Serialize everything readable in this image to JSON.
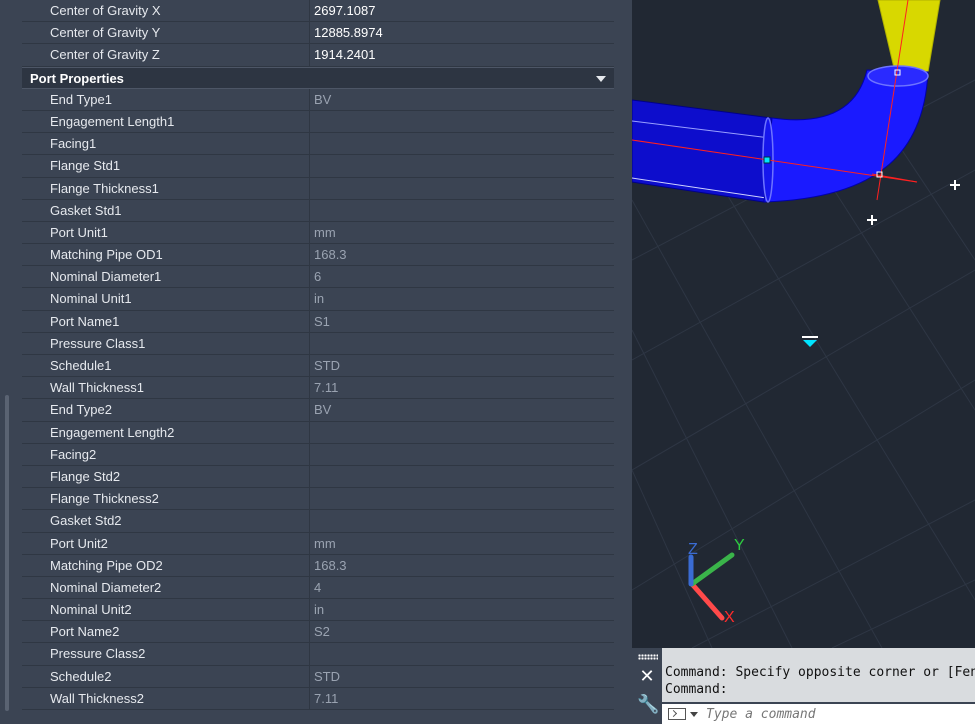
{
  "properties": {
    "top_rows": [
      {
        "name": "Center of Gravity X",
        "value": "2697.1087"
      },
      {
        "name": "Center of Gravity Y",
        "value": "12885.8974"
      },
      {
        "name": "Center of Gravity Z",
        "value": "1914.2401"
      }
    ],
    "section_title": "Port Properties",
    "port_rows": [
      {
        "name": "End Type1",
        "value": "BV"
      },
      {
        "name": "Engagement Length1",
        "value": ""
      },
      {
        "name": "Facing1",
        "value": ""
      },
      {
        "name": "Flange Std1",
        "value": ""
      },
      {
        "name": "Flange Thickness1",
        "value": ""
      },
      {
        "name": "Gasket Std1",
        "value": ""
      },
      {
        "name": "Port Unit1",
        "value": "mm"
      },
      {
        "name": "Matching Pipe OD1",
        "value": "168.3"
      },
      {
        "name": "Nominal Diameter1",
        "value": "6"
      },
      {
        "name": "Nominal Unit1",
        "value": "in"
      },
      {
        "name": "Port Name1",
        "value": "S1"
      },
      {
        "name": "Pressure Class1",
        "value": ""
      },
      {
        "name": "Schedule1",
        "value": "STD"
      },
      {
        "name": "Wall Thickness1",
        "value": "7.11"
      },
      {
        "name": "End Type2",
        "value": "BV"
      },
      {
        "name": "Engagement Length2",
        "value": ""
      },
      {
        "name": "Facing2",
        "value": ""
      },
      {
        "name": "Flange Std2",
        "value": ""
      },
      {
        "name": "Flange Thickness2",
        "value": ""
      },
      {
        "name": "Gasket Std2",
        "value": ""
      },
      {
        "name": "Port Unit2",
        "value": "mm"
      },
      {
        "name": "Matching Pipe OD2",
        "value": "168.3"
      },
      {
        "name": "Nominal Diameter2",
        "value": "4"
      },
      {
        "name": "Nominal Unit2",
        "value": "in"
      },
      {
        "name": "Port Name2",
        "value": "S2"
      },
      {
        "name": "Pressure Class2",
        "value": ""
      },
      {
        "name": "Schedule2",
        "value": "STD"
      },
      {
        "name": "Wall Thickness2",
        "value": "7.11"
      }
    ]
  },
  "viewport": {
    "ucs_labels": {
      "x": "X",
      "y": "Y",
      "z": "Z"
    },
    "colors": {
      "background": "#212833",
      "pipe": "#1a1aff",
      "pipe_dark": "#0d0dcc",
      "pipe_yellow": "#e0e000",
      "grip": "#00e5ff",
      "axis_red": "#ff2b2b"
    }
  },
  "command_line": {
    "history": [
      "Command: Specify opposite corner or [Fence/WPolygon/CPolygon]:",
      "Command:"
    ],
    "placeholder": "Type a command"
  }
}
